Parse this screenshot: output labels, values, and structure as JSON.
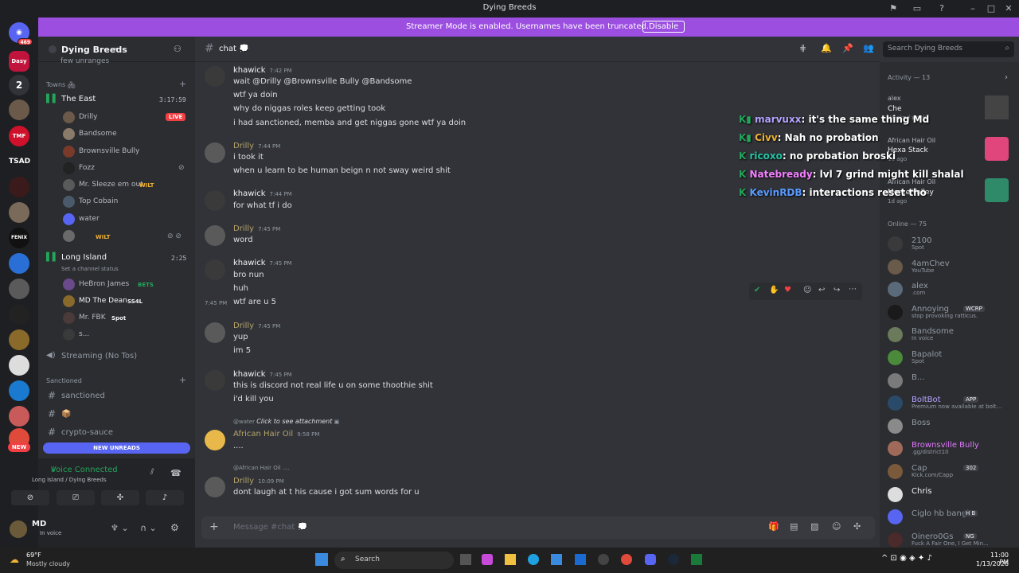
{
  "window": {
    "title": "Dying Breeds"
  },
  "banner": {
    "text": "Streamer Mode is enabled. Usernames have been truncated.",
    "button": "Disable"
  },
  "servers": {
    "home_badge": "469",
    "items": [
      {
        "label": "Dasy"
      },
      {
        "label": "2"
      },
      {
        "label": "TMF"
      },
      {
        "label": "TSAD"
      },
      {
        "label": "FENIX"
      }
    ],
    "new_label": "NEW"
  },
  "server": {
    "name": "Dying Breeds",
    "truncated_top": "few unranges"
  },
  "channels": {
    "towns_cat": "Towns 🏘",
    "east": {
      "name": "The East",
      "timer": "3:17:59",
      "users": [
        {
          "name": "Drilly",
          "live": "LIVE"
        },
        {
          "name": "Bandsome"
        },
        {
          "name": "Brownsville Bully"
        },
        {
          "name": "Fozz"
        },
        {
          "name": "Mr. Sleeze em out",
          "tag": "WILT"
        },
        {
          "name": "Top Cobain"
        },
        {
          "name": "water"
        },
        {
          "name": "",
          "tag": "WILT"
        }
      ]
    },
    "long": {
      "name": "Long Island",
      "timer": "2:25",
      "status": "Set a channel status",
      "users": [
        {
          "name": "HeBron James",
          "tag": "BETS"
        },
        {
          "name": "MD The Dean",
          "tag": "SS4L"
        },
        {
          "name": "Mr. FBK",
          "tag": "Spot"
        },
        {
          "name": "s..."
        }
      ]
    },
    "streaming": "Streaming (No Tos)",
    "sanctioned_cat": "Sanctioned",
    "text": [
      {
        "name": "sanctioned"
      },
      {
        "name": "📦"
      },
      {
        "name": "crypto-sauce"
      }
    ],
    "new_unreads": "NEW UNREADS"
  },
  "voice": {
    "status": "Voice Connected",
    "where": "Long Island / Dying Breeds"
  },
  "user": {
    "name": "MD",
    "status": "In voice"
  },
  "chat": {
    "channel": "chat 💭",
    "search": "Search Dying Breeds",
    "composer": "Message #chat 💭"
  },
  "messages": [
    {
      "author": "khawick",
      "time": "7:42 PM",
      "lines": [
        "wait @Drilly @Brownsville Bully @Bandsome",
        "wtf ya doin",
        "why do niggas roles keep getting took",
        "i had sanctioned, memba and get niggas gone wtf ya doin"
      ]
    },
    {
      "author": "Drilly",
      "time": "7:44 PM",
      "lines": [
        "i took it",
        "when u learn to be human beign n not sway weird shit"
      ]
    },
    {
      "author": "khawick",
      "time": "7:44 PM",
      "lines": [
        "for what tf i do"
      ]
    },
    {
      "author": "Drilly",
      "time": "7:45 PM",
      "lines": [
        "word"
      ]
    },
    {
      "author": "khawick",
      "time": "7:45 PM",
      "lines": [
        "bro nun",
        "huh",
        "wtf are u 5"
      ],
      "side_time": "7:45 PM"
    },
    {
      "author": "Drilly",
      "time": "7:45 PM",
      "lines": [
        "yup",
        "im 5"
      ]
    },
    {
      "author": "khawick",
      "time": "7:45 PM",
      "lines": [
        "this is discord not real life u on some thoothie shit",
        "i'd kill you"
      ]
    },
    {
      "reply_to": "@water",
      "reply_text": "Click to see attachment",
      "author": "African Hair Oil",
      "time": "9:58 PM",
      "lines": [
        "...."
      ]
    },
    {
      "reply_to": "@African Hair Oil ....",
      "author": "Drilly",
      "time": "10:09 PM",
      "lines": [
        "dont laugh at t his  cause i got sum words for u"
      ]
    }
  ],
  "activity": {
    "header": "Activity — 13",
    "items": [
      {
        "name": "alex",
        "text": "Che",
        "sub": "Weeknd week"
      },
      {
        "name": "African Hair Oil",
        "text": "Hexa Stack",
        "sub": "1d ago"
      },
      {
        "name": "African Hair Oil",
        "text": "Merge Valley",
        "sub": "1d ago"
      }
    ]
  },
  "online": {
    "header": "Online — 75",
    "members": [
      {
        "name": "2100",
        "sub": "Spot"
      },
      {
        "name": "4amChev",
        "sub": "YouTube"
      },
      {
        "name": "alex",
        "sub": ".com"
      },
      {
        "name": "Annoying",
        "sub": "stop provoking ratticus.",
        "tag": "WCRP"
      },
      {
        "name": "Bandsome",
        "sub": "In voice"
      },
      {
        "name": "Bapalot",
        "sub": "Spot"
      },
      {
        "name": "B...",
        "sub": ""
      },
      {
        "name": "BoltBot",
        "sub": "Premium now available at bolt...",
        "tag": "APP"
      },
      {
        "name": "Boss",
        "sub": ""
      },
      {
        "name": "Brownsville Bully",
        "sub": ".gg/district10"
      },
      {
        "name": "Cap",
        "sub": "Kick.com/Capp",
        "tag": "302"
      },
      {
        "name": "Chris",
        "sub": ""
      },
      {
        "name": "Ciglo hb bangin",
        "sub": "",
        "tag": "H B"
      },
      {
        "name": "Oinero0Gs",
        "sub": "Fuck A Fair One, I Get Min...",
        "tag": "NG"
      }
    ]
  },
  "overlay": [
    {
      "user": "marvuxx",
      "text": "it's the same thing Md"
    },
    {
      "user": "Civv",
      "text": "Nah no probation"
    },
    {
      "user": "ricoxo",
      "text": "no probation broski"
    },
    {
      "user": "Natebready",
      "text": "lvl 7 grind might kill shalal"
    },
    {
      "user": "KevinRDB",
      "text": "interactions reset tho"
    }
  ],
  "taskbar": {
    "temp": "69°F",
    "weather": "Mostly cloudy",
    "search": "Search",
    "time": "11:00 PM",
    "date": "1/13/2026"
  },
  "colors": {
    "accent": "#5865f2",
    "banner": "#9b4ee0",
    "live": "#f23f43",
    "online": "#23a55a"
  }
}
